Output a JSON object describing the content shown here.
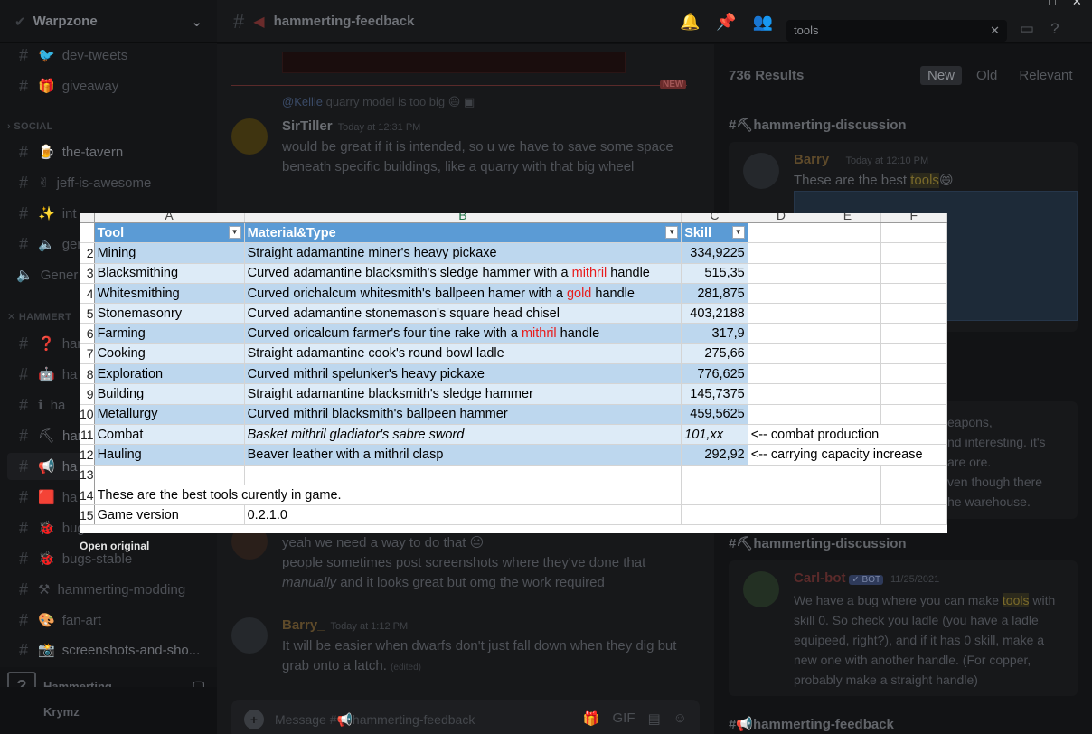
{
  "window": {
    "minimize": "□",
    "close": "✕"
  },
  "server": {
    "name": "Warpzone"
  },
  "sidebar": {
    "channels_top": [
      {
        "name": "dev-tweets",
        "emoji": "🐦"
      },
      {
        "name": "giveaway",
        "emoji": "🎁"
      }
    ],
    "category_social": "SOCIAL",
    "social": [
      {
        "name": "the-tavern",
        "emoji": "🍺"
      },
      {
        "name": "jeff-is-awesome",
        "emoji": "✌"
      },
      {
        "name": "int",
        "emoji": "✨"
      },
      {
        "name": "gen",
        "emoji": "🔈"
      },
      {
        "name": "Gener",
        "emoji": "🔈"
      }
    ],
    "category_hammerting": "HAMMERT",
    "hammerting": [
      {
        "name": "ham",
        "emoji": "❓"
      },
      {
        "name": "ha",
        "emoji": "🤖"
      },
      {
        "name": "ha",
        "emoji": "ℹ"
      },
      {
        "name": "ham",
        "emoji": "⛏"
      },
      {
        "name": "ha",
        "emoji": "📢"
      },
      {
        "name": "ha",
        "emoji": "🟥"
      },
      {
        "name": "bug",
        "emoji": "🐞"
      },
      {
        "name": "bugs-stable",
        "emoji": "🐞"
      },
      {
        "name": "hammerting-modding",
        "emoji": "⚒"
      },
      {
        "name": "fan-art",
        "emoji": "🎨"
      },
      {
        "name": "screenshots-and-sho...",
        "emoji": "📸"
      }
    ],
    "voice_server": "Hammerting",
    "user": "Krymz"
  },
  "header": {
    "channel": "hammerting-feedback",
    "search_value": "tools"
  },
  "chat": {
    "new_badge": "NEW",
    "reply_to": "@Kellie",
    "reply_text": "quarry model is too big 😄",
    "msg1_author": "SirTiller",
    "msg1_time": "Today at 12:31 PM",
    "msg1_text": "would be great if it is intended, so u we have to save some space beneath specific buildings, like a quarry with that big wheel",
    "msg2_text1": "yeah we need a way to do that 😐",
    "msg2_text2a": "people sometimes post screenshots where they've done that ",
    "msg2_text2b": "manually",
    "msg2_text2c": " and it looks great but omg the work required",
    "msg3_author": "Barry_",
    "msg3_time": "Today at 1:12 PM",
    "msg3_text": "It will be easier when dwarfs don't just fall down when they dig but grab onto a latch.",
    "msg3_edited": "(edited)",
    "composer_placeholder": "Message #📢hammerting-feedback"
  },
  "results": {
    "count": "736 Results",
    "sort": [
      "New",
      "Old",
      "Relevant"
    ],
    "r1_channel": "#⛏hammerting-discussion",
    "r1_author": "Barry_",
    "r1_time": "Today at 12:10 PM",
    "r1_text_a": "These are the best ",
    "r1_text_hl": "tools",
    "r1_text_b": "😄",
    "r2_lines": [
      "eapons,",
      "nd interesting. it's",
      "are ore.",
      "ven though there",
      "he warehouse."
    ],
    "r3_channel": "#⛏hammerting-discussion",
    "r3_author": "Carl-bot",
    "r3_badge": "✓ BOT",
    "r3_time": "11/25/2021",
    "r3_text_a": "We have a bug where you can make ",
    "r3_text_hl": "tools",
    "r3_text_b": " with skill 0. So check you ladle (you have a ladle equipeed, right?), and if it has 0 skill, make a new one with another handle. (For copper, probably make a straight handle)",
    "r4_channel": "#📢hammerting-feedback"
  },
  "sheet": {
    "columns": [
      "A",
      "B",
      "C",
      "D",
      "E",
      "F"
    ],
    "headers": [
      "Tool",
      "Material&Type",
      "Skill"
    ],
    "rows": [
      {
        "n": "2",
        "tool": "Mining",
        "mat": "Straight adamantine miner's heavy pickaxe",
        "skill": "334,9225"
      },
      {
        "n": "3",
        "tool": "Blacksmithing",
        "mat_a": "Curved adamantine blacksmith's sledge hammer with a ",
        "mat_red": "mithril",
        "mat_b": " handle",
        "skill": "515,35"
      },
      {
        "n": "4",
        "tool": "Whitesmithing",
        "mat_a": "Curved orichalcum whitesmith's ballpeen hamer with a ",
        "mat_red": "gold",
        "mat_b": " handle",
        "skill": "281,875"
      },
      {
        "n": "5",
        "tool": "Stonemasonry",
        "mat": "Curved adamantine stonemason's square head chisel",
        "skill": "403,2188"
      },
      {
        "n": "6",
        "tool": "Farming",
        "mat_a": "Curved oricalcum farmer's four tine rake with a ",
        "mat_red": "mithril",
        "mat_b": " handle",
        "skill": "317,9"
      },
      {
        "n": "7",
        "tool": "Cooking",
        "mat": "Straight adamantine cook's round bowl ladle",
        "skill": "275,66"
      },
      {
        "n": "8",
        "tool": "Exploration",
        "mat": "Curved mithril spelunker's heavy pickaxe",
        "skill": "776,625"
      },
      {
        "n": "9",
        "tool": "Building",
        "mat": "Straight adamantine blacksmith's sledge hammer",
        "skill": "145,7375"
      },
      {
        "n": "10",
        "tool": "Metallurgy",
        "mat": "Curved mithril blacksmith's ballpeen hammer",
        "skill": "459,5625"
      },
      {
        "n": "11",
        "tool": "Combat",
        "mat": "Basket mithril gladiator's sabre sword",
        "skill": "101,xx",
        "note": "<-- combat production"
      },
      {
        "n": "12",
        "tool": "Hauling",
        "mat": "Beaver leather with a mithril clasp",
        "skill": "292,92",
        "note": "<-- carrying capacity increase"
      }
    ],
    "row13": "13",
    "row14_n": "14",
    "row14_text": "These are the best tools curently in game.",
    "row15_n": "15",
    "row15_label": "Game version",
    "row15_value": "0.2.1.0"
  },
  "open_original": "Open original"
}
